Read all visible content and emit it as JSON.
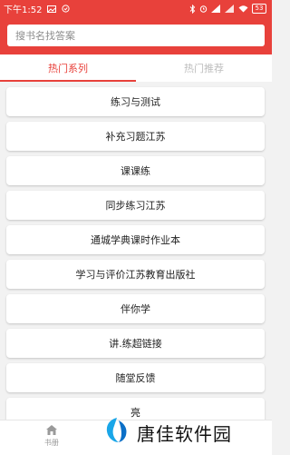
{
  "status": {
    "time": "下午1:52",
    "battery": "53"
  },
  "search": {
    "placeholder": "搜书名找答案"
  },
  "tabs": [
    {
      "label": "热门系列",
      "active": true
    },
    {
      "label": "热门推荐",
      "active": false
    }
  ],
  "list": [
    "练习与测试",
    "补充习题江苏",
    "课课练",
    "同步练习江苏",
    "通城学典课时作业本",
    "学习与评价江苏教育出版社",
    "伴你学",
    "讲.练超链接",
    "随堂反馈",
    "亮"
  ],
  "bottom_nav": {
    "bookshelf_label": "书册"
  },
  "watermark": {
    "text": "唐佳软件园"
  },
  "colors": {
    "accent": "#e8413b",
    "background": "#f2f2f2"
  }
}
